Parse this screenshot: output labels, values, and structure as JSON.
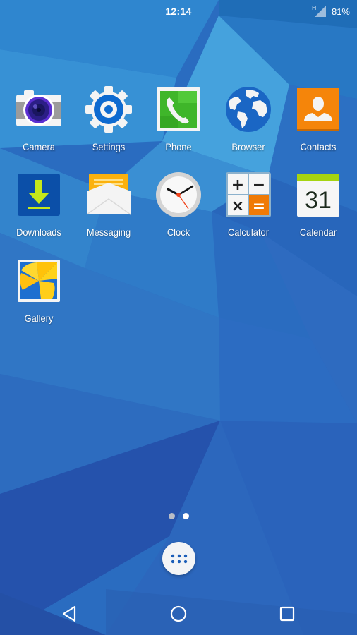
{
  "status_bar": {
    "time": "12:14",
    "network_type": "H",
    "signal_icon": "cellular-signal-icon",
    "battery_percent": "81%"
  },
  "apps": [
    {
      "label": "Camera",
      "icon": "camera-icon"
    },
    {
      "label": "Settings",
      "icon": "gear-icon"
    },
    {
      "label": "Phone",
      "icon": "phone-icon"
    },
    {
      "label": "Browser",
      "icon": "globe-icon"
    },
    {
      "label": "Contacts",
      "icon": "person-icon"
    },
    {
      "label": "Downloads",
      "icon": "download-arrow-icon"
    },
    {
      "label": "Messaging",
      "icon": "envelope-icon"
    },
    {
      "label": "Clock",
      "icon": "clock-icon"
    },
    {
      "label": "Calculator",
      "icon": "calculator-icon"
    },
    {
      "label": "Calendar",
      "icon": "calendar-icon",
      "day": "31"
    },
    {
      "label": "Gallery",
      "icon": "flower-photo-icon"
    }
  ],
  "calculator_glyphs": [
    "+",
    "−",
    "×",
    "="
  ],
  "page_indicator": {
    "total_pages": 2,
    "current_page": 2
  },
  "dock": {
    "app_drawer_icon": "app-drawer-grid-icon"
  },
  "nav_bar": {
    "back": "back-triangle-icon",
    "home": "home-circle-icon",
    "recents": "recents-square-icon"
  },
  "colors": {
    "wallpaper_base": "#2b6fc2",
    "contacts_orange": "#f5850a",
    "phone_green": "#3fb62a",
    "downloads_blue": "#0b4fa8",
    "download_arrow": "#c6e81a",
    "calendar_green": "#a6d411",
    "calculator_orange": "#f07a06",
    "clock_second_hand": "#f0421a"
  }
}
